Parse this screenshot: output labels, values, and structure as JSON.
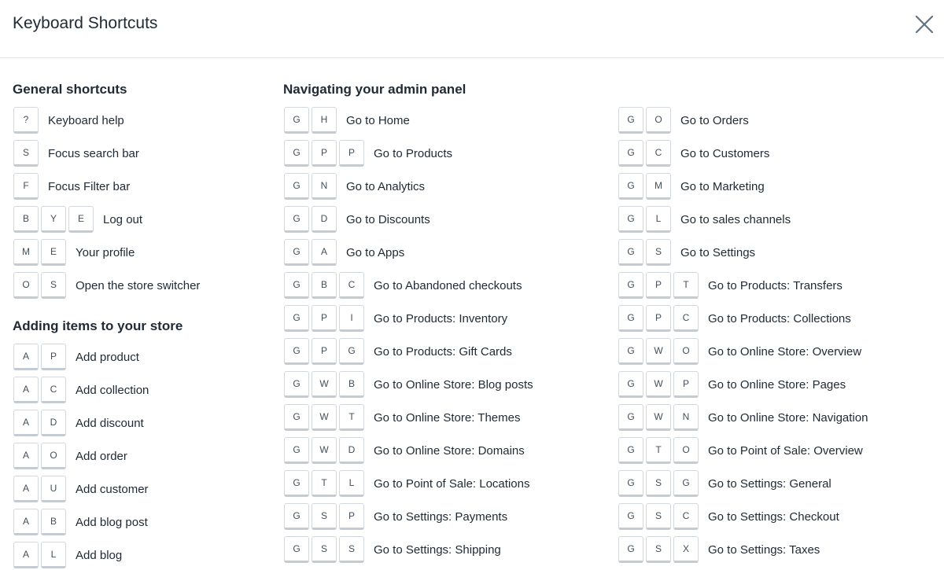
{
  "header": {
    "title": "Keyboard Shortcuts"
  },
  "general": {
    "title": "General shortcuts",
    "items": [
      {
        "keys": [
          "?"
        ],
        "label": "Keyboard help"
      },
      {
        "keys": [
          "S"
        ],
        "label": "Focus search bar"
      },
      {
        "keys": [
          "F"
        ],
        "label": "Focus Filter bar"
      },
      {
        "keys": [
          "B",
          "Y",
          "E"
        ],
        "label": "Log out"
      },
      {
        "keys": [
          "M",
          "E"
        ],
        "label": "Your profile"
      },
      {
        "keys": [
          "O",
          "S"
        ],
        "label": "Open the store switcher"
      }
    ]
  },
  "adding": {
    "title": "Adding items to your store",
    "items": [
      {
        "keys": [
          "A",
          "P"
        ],
        "label": "Add product"
      },
      {
        "keys": [
          "A",
          "C"
        ],
        "label": "Add collection"
      },
      {
        "keys": [
          "A",
          "D"
        ],
        "label": "Add discount"
      },
      {
        "keys": [
          "A",
          "O"
        ],
        "label": "Add order"
      },
      {
        "keys": [
          "A",
          "U"
        ],
        "label": "Add customer"
      },
      {
        "keys": [
          "A",
          "B"
        ],
        "label": "Add blog post"
      },
      {
        "keys": [
          "A",
          "L"
        ],
        "label": "Add blog"
      }
    ]
  },
  "navigating": {
    "title": "Navigating your admin panel",
    "col1": [
      {
        "keys": [
          "G",
          "H"
        ],
        "label": "Go to Home"
      },
      {
        "keys": [
          "G",
          "P",
          "P"
        ],
        "label": "Go to Products"
      },
      {
        "keys": [
          "G",
          "N"
        ],
        "label": "Go to Analytics"
      },
      {
        "keys": [
          "G",
          "D"
        ],
        "label": "Go to Discounts"
      },
      {
        "keys": [
          "G",
          "A"
        ],
        "label": "Go to Apps"
      },
      {
        "keys": [
          "G",
          "B",
          "C"
        ],
        "label": "Go to Abandoned checkouts"
      },
      {
        "keys": [
          "G",
          "P",
          "I"
        ],
        "label": "Go to Products: Inventory"
      },
      {
        "keys": [
          "G",
          "P",
          "G"
        ],
        "label": "Go to Products: Gift Cards"
      },
      {
        "keys": [
          "G",
          "W",
          "B"
        ],
        "label": "Go to Online Store: Blog posts"
      },
      {
        "keys": [
          "G",
          "W",
          "T"
        ],
        "label": "Go to Online Store: Themes"
      },
      {
        "keys": [
          "G",
          "W",
          "D"
        ],
        "label": "Go to Online Store: Domains"
      },
      {
        "keys": [
          "G",
          "T",
          "L"
        ],
        "label": "Go to Point of Sale: Locations"
      },
      {
        "keys": [
          "G",
          "S",
          "P"
        ],
        "label": "Go to Settings: Payments"
      },
      {
        "keys": [
          "G",
          "S",
          "S"
        ],
        "label": "Go to Settings: Shipping"
      }
    ],
    "col2": [
      {
        "keys": [
          "G",
          "O"
        ],
        "label": "Go to Orders"
      },
      {
        "keys": [
          "G",
          "C"
        ],
        "label": "Go to Customers"
      },
      {
        "keys": [
          "G",
          "M"
        ],
        "label": "Go to Marketing"
      },
      {
        "keys": [
          "G",
          "L"
        ],
        "label": "Go to sales channels"
      },
      {
        "keys": [
          "G",
          "S"
        ],
        "label": "Go to Settings"
      },
      {
        "keys": [
          "G",
          "P",
          "T"
        ],
        "label": "Go to Products: Transfers"
      },
      {
        "keys": [
          "G",
          "P",
          "C"
        ],
        "label": "Go to Products: Collections"
      },
      {
        "keys": [
          "G",
          "W",
          "O"
        ],
        "label": "Go to Online Store: Overview"
      },
      {
        "keys": [
          "G",
          "W",
          "P"
        ],
        "label": "Go to Online Store: Pages"
      },
      {
        "keys": [
          "G",
          "W",
          "N"
        ],
        "label": "Go to Online Store: Navigation"
      },
      {
        "keys": [
          "G",
          "T",
          "O"
        ],
        "label": "Go to Point of Sale: Overview"
      },
      {
        "keys": [
          "G",
          "S",
          "G"
        ],
        "label": "Go to Settings: General"
      },
      {
        "keys": [
          "G",
          "S",
          "C"
        ],
        "label": "Go to Settings: Checkout"
      },
      {
        "keys": [
          "G",
          "S",
          "X"
        ],
        "label": "Go to Settings: Taxes"
      }
    ]
  }
}
